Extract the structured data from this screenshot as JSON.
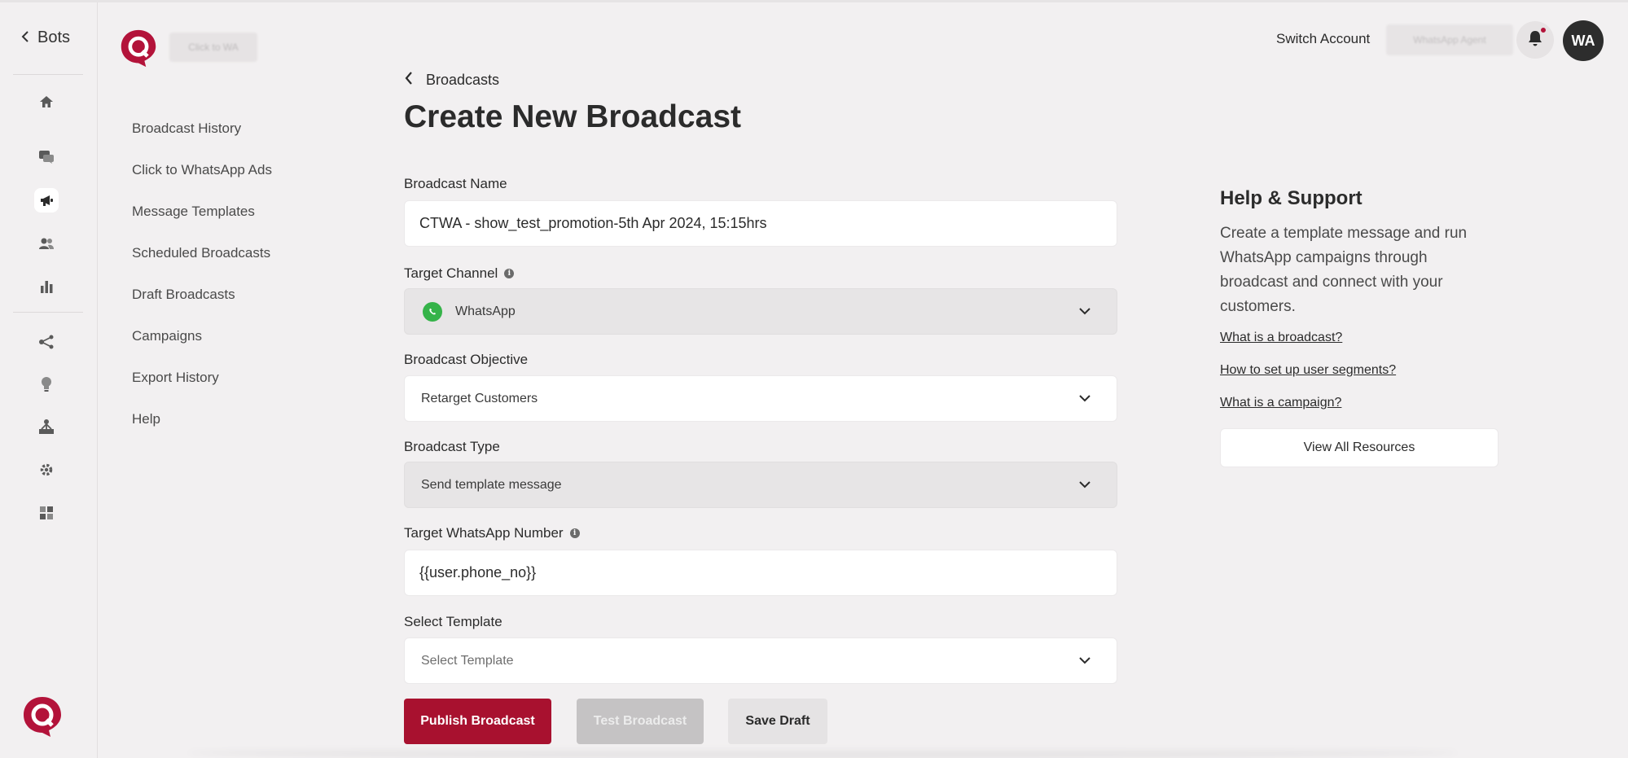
{
  "rail": {
    "back_label": "Bots",
    "icons": [
      "home-icon",
      "chat-icon",
      "megaphone-icon",
      "users-icon",
      "bar-chart-icon",
      "flow-icon",
      "bulb-icon",
      "hierarchy-icon",
      "gear-icon",
      "integrations-icon"
    ],
    "active_icon": "megaphone-icon"
  },
  "brand": {
    "logo": "haptik-logo",
    "workspace_name": "Click to WA"
  },
  "subnav": {
    "items": [
      "Broadcast History",
      "Click to WhatsApp Ads",
      "Message Templates",
      "Scheduled Broadcasts",
      "Draft Broadcasts",
      "Campaigns",
      "Export History",
      "Help"
    ]
  },
  "header": {
    "switch_account": "Switch Account",
    "agent_name": "WhatsApp Agent",
    "avatar_initials": "WA",
    "notification_dot_color": "#b3133a"
  },
  "main": {
    "breadcrumb": "Broadcasts",
    "title": "Create New Broadcast",
    "broadcast_name": {
      "label": "Broadcast Name",
      "value": "CTWA - show_test_promotion-5th Apr 2024, 15:15hrs"
    },
    "target_channel": {
      "label": "Target Channel",
      "value": "WhatsApp"
    },
    "objective": {
      "label": "Broadcast Objective",
      "value": "Retarget Customers"
    },
    "type": {
      "label": "Broadcast Type",
      "value": "Send template message"
    },
    "target_number": {
      "label": "Target WhatsApp Number",
      "value": "{{user.phone_no}}"
    },
    "template": {
      "label": "Select Template",
      "placeholder": "Select Template"
    },
    "buttons": {
      "publish": "Publish Broadcast",
      "test": "Test Broadcast",
      "save_draft": "Save Draft"
    },
    "accent_color": "#a8112f"
  },
  "help": {
    "title": "Help & Support",
    "description": "Create a template message and run WhatsApp campaigns through broadcast and connect with your customers.",
    "links": [
      "What is a broadcast?",
      "How to set up user segments?",
      "What is a campaign?"
    ],
    "view_all": "View All Resources"
  }
}
